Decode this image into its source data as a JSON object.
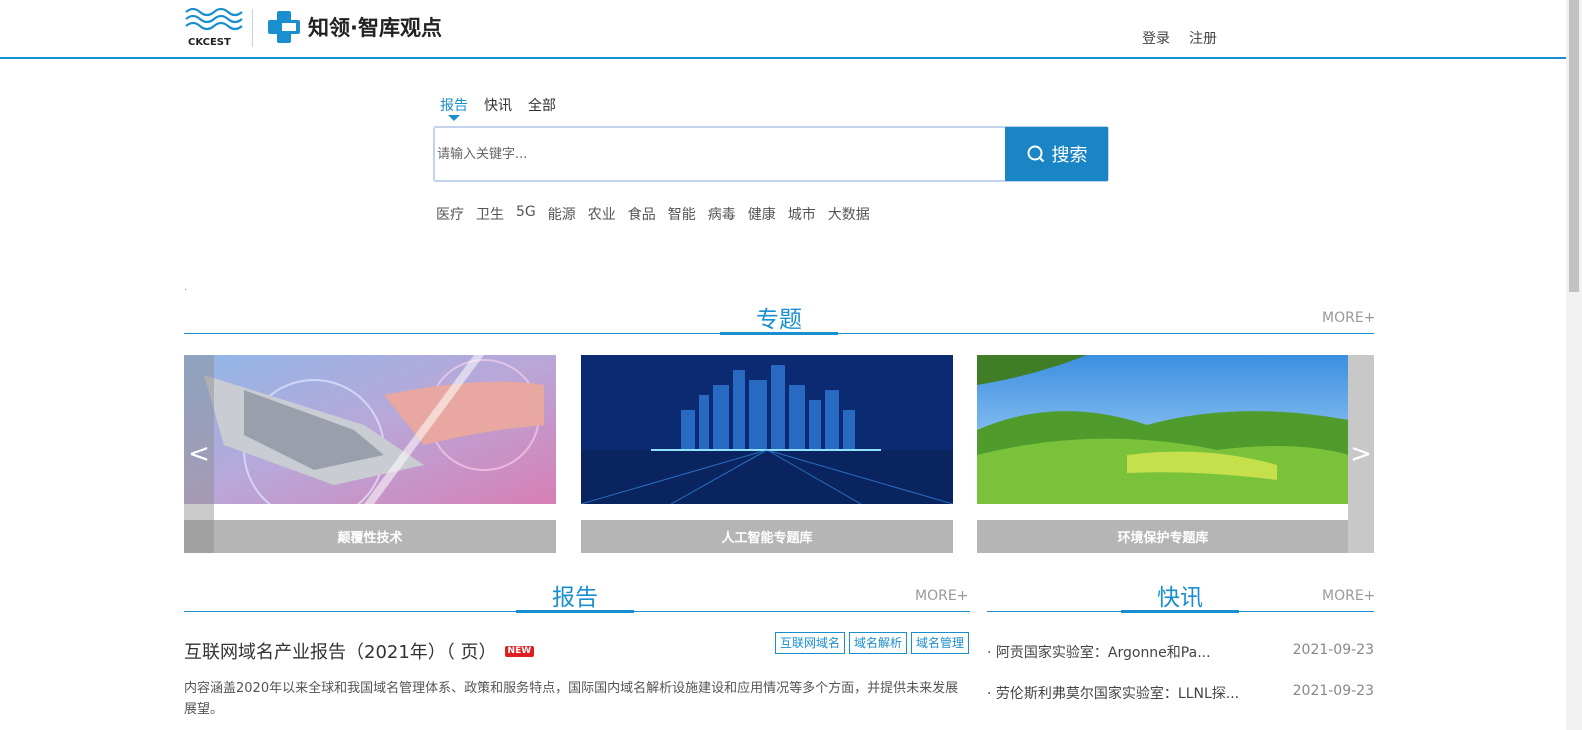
{
  "header": {
    "logo_text": "CKCEST",
    "brand_title": "知领·智库观点",
    "login": "登录",
    "register": "注册"
  },
  "search": {
    "tabs": [
      "报告",
      "快讯",
      "全部"
    ],
    "active_tab": "报告",
    "placeholder": "请输入关键字...",
    "button_label": "搜索",
    "hot_keywords": [
      "医疗",
      "卫生",
      "5G",
      "能源",
      "农业",
      "食品",
      "智能",
      "病毒",
      "健康",
      "城市",
      "大数据"
    ]
  },
  "topics": {
    "title": "专题",
    "more": "MORE+",
    "prev": "<",
    "next": ">",
    "cards": [
      {
        "caption": "颠覆性技术",
        "image": "robot-human-handshake"
      },
      {
        "caption": "人工智能专题库",
        "image": "digital-city-skyline"
      },
      {
        "caption": "环境保护专题库",
        "image": "green-grassland-landscape"
      }
    ]
  },
  "reports": {
    "title": "报告",
    "more": "MORE+",
    "items": [
      {
        "title": "互联网域名产业报告（2021年）（ 页）",
        "badge": "NEW",
        "tags": [
          "互联网域名",
          "域名解析",
          "域名管理"
        ],
        "description": "内容涵盖2020年以来全球和我国域名管理体系、政策和服务特点，国际国内域名解析设施建设和应用情况等多个方面，并提供未来发展展望。"
      }
    ]
  },
  "news": {
    "title": "快讯",
    "more": "MORE+",
    "items": [
      {
        "title": "· 阿贡国家实验室：Argonne和Pa...",
        "date": "2021-09-23"
      },
      {
        "title": "· 劳伦斯利弗莫尔国家实验室：LLNL探...",
        "date": "2021-09-23"
      }
    ]
  },
  "colors": {
    "accent": "#1a8fd0",
    "search_button": "#1a85c4",
    "caption_bg": "#b5b5b5"
  }
}
